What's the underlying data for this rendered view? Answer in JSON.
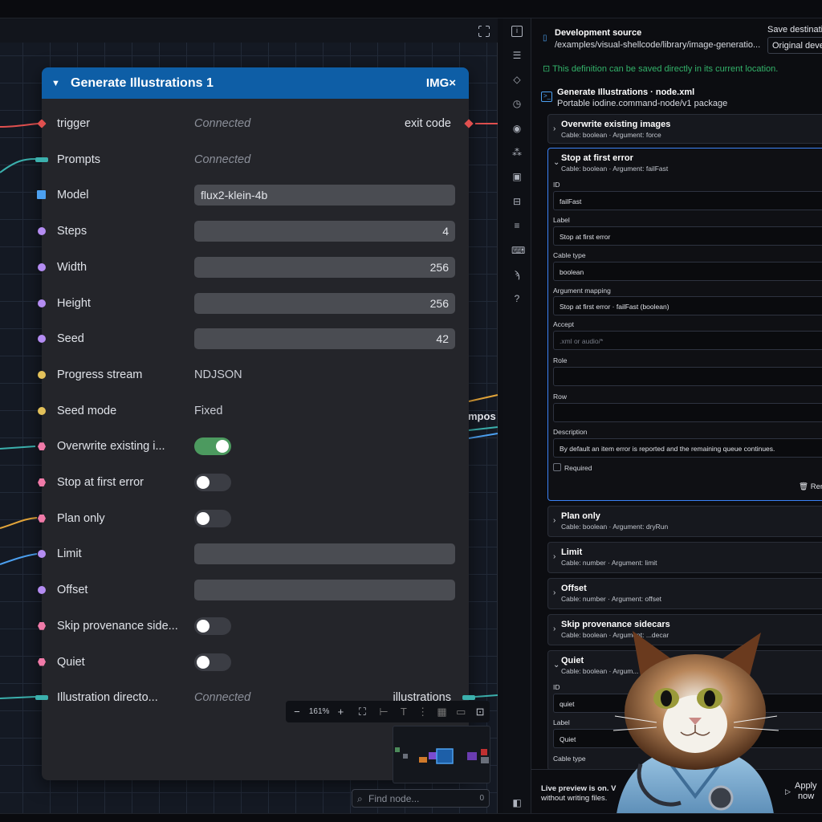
{
  "node": {
    "title": "Generate Illustrations 1",
    "badge": "IMG×",
    "ports": [
      {
        "label": "trigger",
        "value": "Connected",
        "kind": "connected",
        "output": "exit code"
      },
      {
        "label": "Prompts",
        "value": "Connected",
        "kind": "connected"
      },
      {
        "label": "Model",
        "value": "flux2-klein-4b",
        "kind": "text"
      },
      {
        "label": "Steps",
        "value": "4",
        "kind": "number"
      },
      {
        "label": "Width",
        "value": "256",
        "kind": "number"
      },
      {
        "label": "Height",
        "value": "256",
        "kind": "number"
      },
      {
        "label": "Seed",
        "value": "42",
        "kind": "number"
      },
      {
        "label": "Progress stream",
        "value": "NDJSON",
        "kind": "static"
      },
      {
        "label": "Seed mode",
        "value": "Fixed",
        "kind": "static"
      },
      {
        "label": "Overwrite existing i...",
        "kind": "toggle",
        "on": true
      },
      {
        "label": "Stop at first error",
        "kind": "toggle",
        "on": false
      },
      {
        "label": "Plan only",
        "kind": "toggle",
        "on": false
      },
      {
        "label": "Limit",
        "value": "",
        "kind": "text"
      },
      {
        "label": "Offset",
        "value": "",
        "kind": "text"
      },
      {
        "label": "Skip provenance side...",
        "kind": "toggle",
        "on": false
      },
      {
        "label": "Quiet",
        "kind": "toggle",
        "on": false
      },
      {
        "label": "Illustration directo...",
        "value": "Connected",
        "kind": "connected",
        "output": "illustrations"
      }
    ]
  },
  "canvas": {
    "zoom": "161%",
    "find_placeholder": "Find node...",
    "find_count": "0",
    "compose_label": "mpos"
  },
  "panel": {
    "source_title": "Development source",
    "source_path": "/examples/visual-shellcode/library/image-generatio...",
    "save_label": "Save destinati",
    "save_value": "Original devel",
    "notice": "This definition can be saved directly in its current location.",
    "package_title": "Generate Illustrations · node.xml",
    "package_sub": "Portable iodine.command-node/v1 package",
    "overwrite": {
      "title": "Overwrite existing images",
      "sub": "Cable: boolean · Argument: force"
    },
    "stop": {
      "title": "Stop at first error",
      "sub": "Cable: boolean · Argument: failFast",
      "id_label": "ID",
      "id_value": "failFast",
      "label_label": "Label",
      "label_value": "Stop at first error",
      "cable_label": "Cable type",
      "cable_value": "boolean",
      "mapping_label": "Argument mapping",
      "mapping_value": "Stop at first error · failFast (boolean)",
      "accept_label": "Accept",
      "accept_placeholder": ".xml or audio/*",
      "role_label": "Role",
      "row_label": "Row",
      "desc_label": "Description",
      "desc_value": "By default an item error is reported and the remaining queue continues.",
      "required_label": "Required",
      "remove_label": "Ren"
    },
    "plan": {
      "title": "Plan only",
      "sub": "Cable: boolean · Argument: dryRun"
    },
    "limit": {
      "title": "Limit",
      "sub": "Cable: number · Argument: limit"
    },
    "offset": {
      "title": "Offset",
      "sub": "Cable: number · Argument: offset"
    },
    "skip": {
      "title": "Skip provenance sidecars",
      "sub": "Cable: boolean · Argument: ...decar"
    },
    "quiet": {
      "title": "Quiet",
      "sub": "Cable: boolean · Argum...",
      "id_label": "ID",
      "id_value": "quiet",
      "label_label": "Label",
      "label_value": "Quiet",
      "cable_label": "Cable type"
    },
    "preview_line1": "Live preview is on. V",
    "preview_line2": "without writing files.",
    "apply_line1": "Apply",
    "apply_line2": "now"
  },
  "colors": {
    "header": "#0e5ea6",
    "accent_blue": "#3b82f6",
    "notice_green": "#33b36a",
    "toggle_on": "#4c9a5f",
    "port_red": "#e0504f",
    "port_teal": "#3bb0ad",
    "port_blue": "#4ca0f0",
    "port_purple": "#b48cf2",
    "port_yellow": "#e3c15a",
    "port_pink": "#f07aa8"
  },
  "icons": [
    "fullscreen-icon",
    "info-icon",
    "list-icon",
    "diamond-icon",
    "clock-icon",
    "play-icon",
    "nodes-icon",
    "terminal-icon",
    "console-icon",
    "sliders-icon",
    "keyboard-icon",
    "plug-icon",
    "help-icon",
    "sidebar-icon",
    "search-icon",
    "trash-icon",
    "file-icon",
    "terminal-pkg-icon"
  ]
}
